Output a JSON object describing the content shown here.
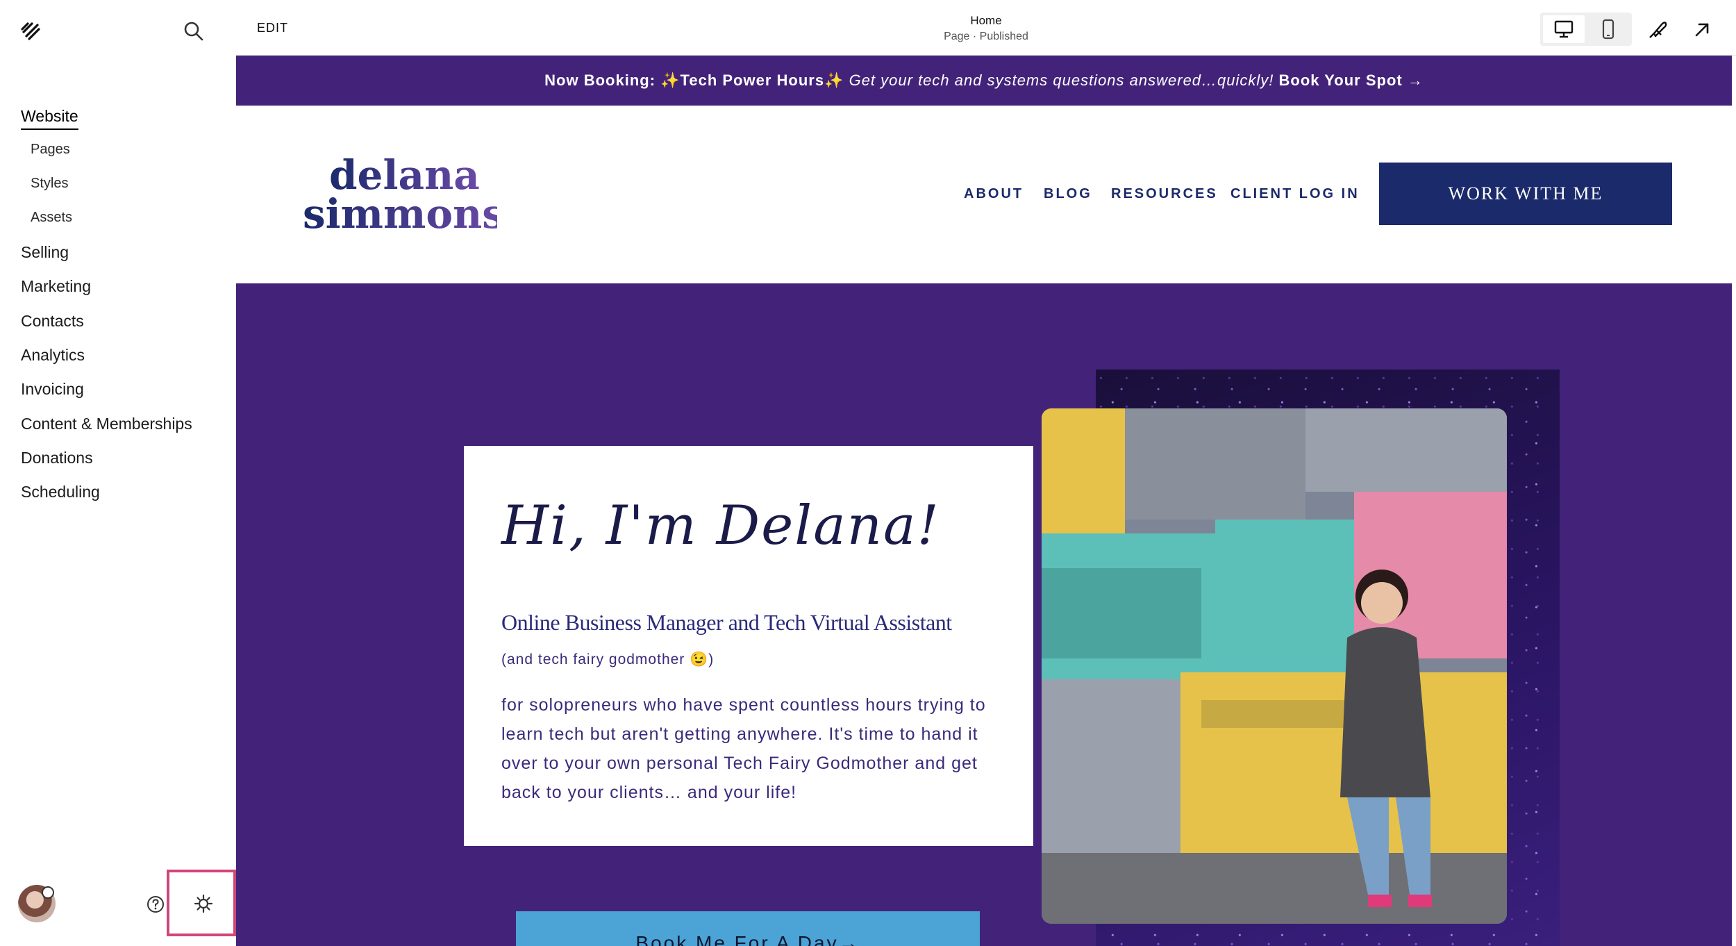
{
  "sidebar": {
    "nav": {
      "website": "Website",
      "sub": {
        "pages": "Pages",
        "styles": "Styles",
        "assets": "Assets"
      },
      "selling": "Selling",
      "marketing": "Marketing",
      "contacts": "Contacts",
      "analytics": "Analytics",
      "invoicing": "Invoicing",
      "content": "Content & Memberships",
      "donations": "Donations",
      "scheduling": "Scheduling"
    },
    "icons": {
      "logo": "squarespace-logo-icon",
      "search": "search-icon",
      "help": "help-icon",
      "settings": "gear-icon"
    }
  },
  "topbar": {
    "edit_label": "EDIT",
    "page_title": "Home",
    "page_status": "Page · Published",
    "icons": {
      "desktop": "desktop-icon",
      "mobile": "mobile-icon",
      "style": "paintbrush-icon",
      "external": "arrow-up-right-icon"
    }
  },
  "site": {
    "announcement": {
      "lead": "Now Booking: ✨Tech Power Hours✨",
      "italic": " Get your tech and systems questions answered…quickly!",
      "link": " Book Your Spot →"
    },
    "logo": {
      "line1": "delana",
      "line2": "simmons"
    },
    "nav": {
      "about": "ABOUT",
      "blog": "BLOG",
      "resources": "RESOURCES",
      "client_login": "CLIENT LOG IN"
    },
    "cta": "WORK WITH ME",
    "hero": {
      "greeting": "Hi, I'm Delana!",
      "role": "Online Business Manager and Tech Virtual Assistant",
      "aside": "(and tech fairy godmother 😉)",
      "body": "for solopreneurs who have spent countless hours trying to learn tech but aren't getting anywhere. It's time to hand it over to your own personal Tech Fairy Godmother and get back to your clients… and your life!",
      "book_button": "Book Me For A Day→"
    }
  },
  "colors": {
    "brand_purple": "#43237a",
    "brand_navy": "#1b2a6b",
    "cta_blue": "#4ba3d6",
    "highlight_pink": "#d0457a"
  }
}
